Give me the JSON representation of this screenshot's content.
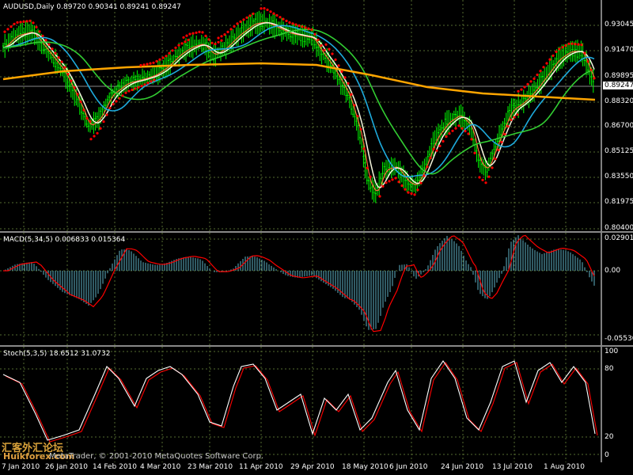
{
  "main_panel": {
    "header": "AUDUSD,Daily  0.89720 0.90341 0.89241 0.89247",
    "price_labels": [
      "0.93045",
      "0.91470",
      "0.89895",
      "0.88320",
      "0.86700",
      "0.85125",
      "0.83550",
      "0.81975",
      "0.80400"
    ],
    "current_price": "0.89247"
  },
  "macd_panel": {
    "header": "MACD(5,34,5) 0.006833 0.015364",
    "labels": [
      "0.029013",
      "0.00",
      "-0.055302"
    ]
  },
  "stoch_panel": {
    "header": "Stoch(5,3,5) 18.6512 31.0732",
    "labels": [
      "100",
      "80",
      "20",
      "0"
    ]
  },
  "x_axis": {
    "labels": [
      "7 Jan 2010",
      "26 Jan 2010",
      "14 Feb 2010",
      "4 Mar 2010",
      "23 Mar 2010",
      "11 Apr 2010",
      "29 Apr 2010",
      "18 May 2010",
      "6 Jun 2010",
      "24 Jun 2010",
      "13 Jul 2010",
      "1 Aug 2010"
    ]
  },
  "watermark": {
    "copyright": "MetaTrader, © 2001-2010 MetaQuotes Software Corp.",
    "site_cn": "汇客外汇论坛",
    "site_url": "Huikforex.com"
  },
  "colors": {
    "candle": "#00ff00",
    "sar": "#ff0000",
    "ma_fast": "#ff6a3d",
    "ma_white": "#f5f5dc",
    "ma_cyan": "#1eaadc",
    "ma_green": "#32cd32",
    "ma_orange": "#ffa500",
    "macd_hist": "#5fb4c8",
    "macd_signal": "#ff0000",
    "stoch_main": "#ffffff",
    "stoch_signal": "#ff0000",
    "grid": "#556b2f"
  }
}
